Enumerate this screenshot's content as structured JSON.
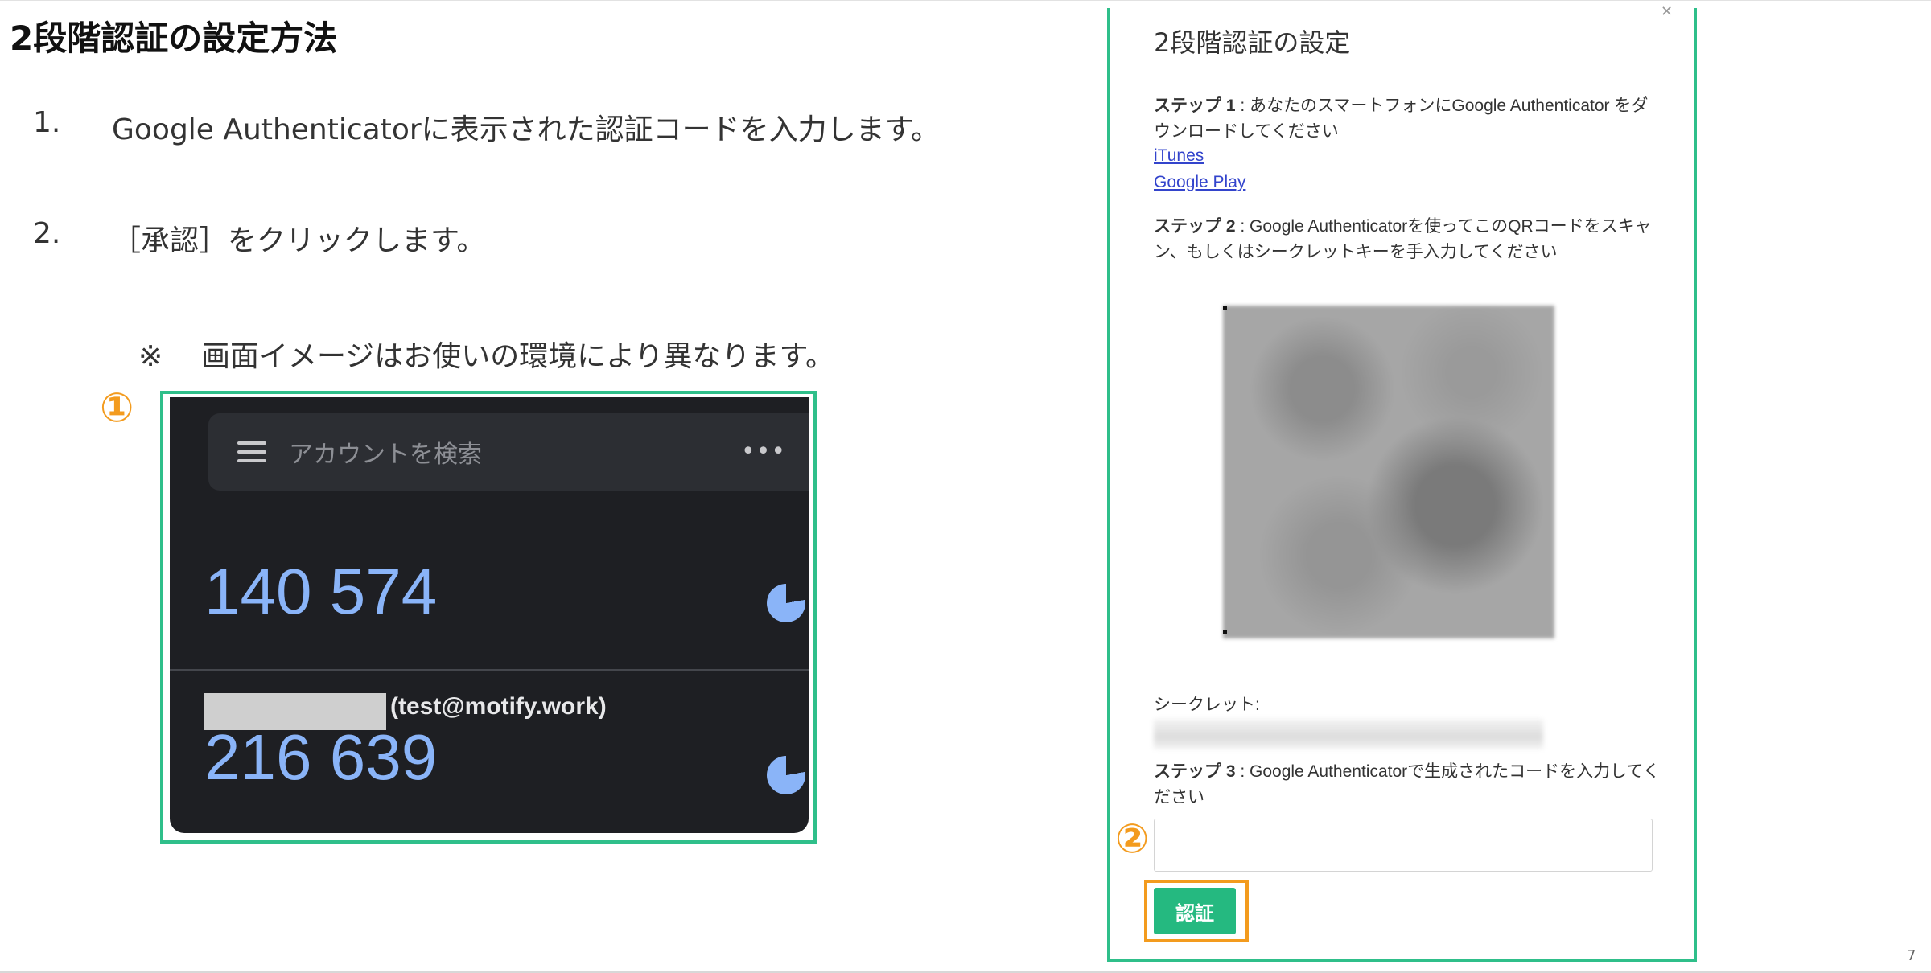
{
  "slide": {
    "title": "2段階認証の設定方法",
    "step1_num": "1.",
    "step1_text": "Google Authenticatorに表示された認証コードを入力します。",
    "step2_num": "2.",
    "step2_text": "［承認］をクリックします。",
    "note_mark": "※",
    "note_text": "画面イメージはお使いの環境により異なります。",
    "callout1": "①",
    "callout2": "②",
    "page_number": "7"
  },
  "authenticator": {
    "search_placeholder": "アカウントを検索",
    "more_label": "•••",
    "code1": "140 574",
    "account2": "(test@motify.work)",
    "code2": "216 639"
  },
  "dialog": {
    "title": "2段階認証の設定",
    "step1_label": "ステップ 1",
    "step1_text": " : あなたのスマートフォンにGoogle Authenticator をダウンロードしてください",
    "link_itunes": "iTunes",
    "link_google_play": "Google Play",
    "step2_label": "ステップ 2",
    "step2_text": " : Google Authenticatorを使ってこのQRコードをスキャン、もしくはシークレットキーを手入力してください",
    "secret_label": "シークレット:",
    "step3_label": "ステップ 3",
    "step3_text": " : Google Authenticatorで生成されたコードを入力してください",
    "code_input_value": "",
    "verify_button": "認証"
  },
  "colors": {
    "frame_green": "#2fbf8a",
    "callout_orange": "#f39b1e",
    "button_green": "#25b980",
    "auth_code_blue": "#8ab4f8"
  }
}
